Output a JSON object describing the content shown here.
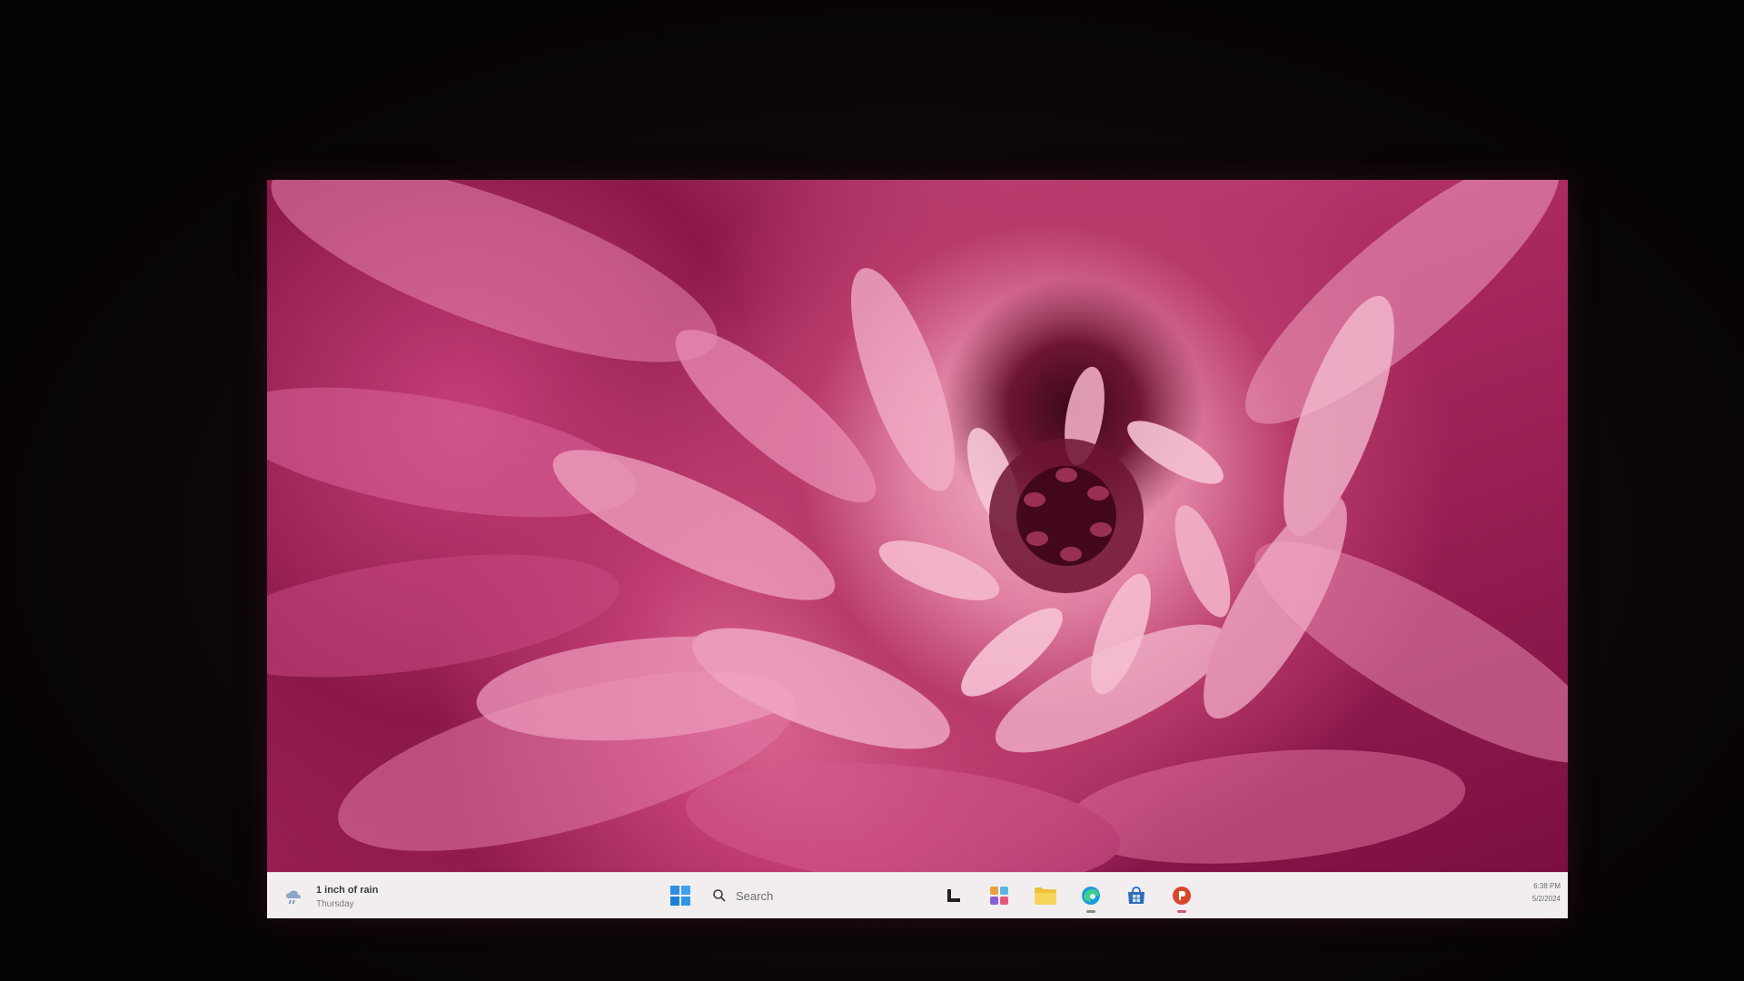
{
  "taskbar": {
    "weather": {
      "title": "1 inch of rain",
      "subtitle": "Thursday"
    },
    "search": {
      "placeholder": "Search"
    },
    "apps": [
      "task-view-icon",
      "copilot-icon",
      "file-explorer-icon",
      "edge-icon",
      "store-icon",
      "powerpoint-icon"
    ],
    "tray": {
      "time": "6:38 PM",
      "date": "5/2/2024"
    }
  },
  "colors": {
    "taskbar": "#f2eef0",
    "accent": "#c2386e",
    "frame": "#0b0708"
  }
}
